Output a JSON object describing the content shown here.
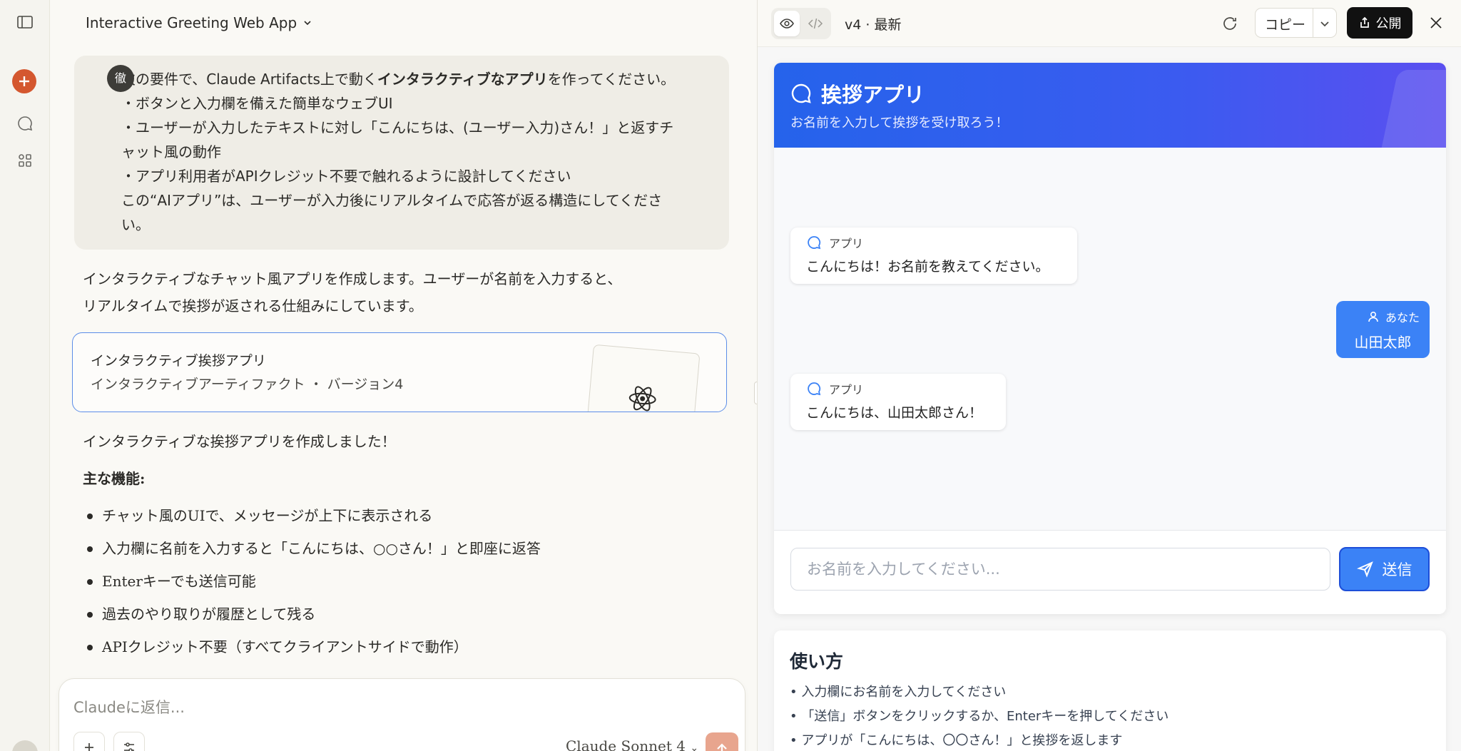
{
  "chat": {
    "title": "Interactive Greeting Web App",
    "user_avatar": "徹",
    "user_message": {
      "l1_pre": "次の要件で、Claude Artifacts上で動く",
      "l1_bold": "インタラクティブなアプリ",
      "l1_post": "を作ってください。",
      "l2": "・ボタンと入力欄を備えた簡単なウェブUI",
      "l3": "・ユーザーが入力したテキストに対し「こんにちは、(ユーザー入力)さん！」と返すチ",
      "l4": "ャット風の動作",
      "l5": "・アプリ利用者がAPIクレジット不要で触れるように設計してください",
      "l6": "この“AIアプリ”は、ユーザーが入力後にリアルタイムで応答が返る構造にしてくださ",
      "l7": "い。"
    },
    "assistant_intro_1": "インタラクティブなチャット風アプリを作成します。ユーザーが名前を入力すると、",
    "assistant_intro_2": "リアルタイムで挨拶が返される仕組みにしています。",
    "artifact": {
      "title": "インタラクティブ挨拶アプリ",
      "subtitle": "インタラクティブアーティファクト ・ バージョン4"
    },
    "assistant_done": "インタラクティブな挨拶アプリを作成しました！",
    "features_title": "主な機能:",
    "features": [
      "チャット風のUIで、メッセージが上下に表示される",
      "入力欄に名前を入力すると「こんにちは、○○さん！」と即座に返答",
      "Enterキーでも送信可能",
      "過去のやり取りが履歴として残る",
      "APIクレジット不要（すべてクライアントサイドで動作）"
    ],
    "reply_placeholder": "Claudeに返信...",
    "model_name": "Claude Sonnet 4"
  },
  "panel": {
    "version": "v4 · 最新",
    "copy_label": "コピー",
    "publish_label": "公開"
  },
  "app": {
    "title": "挨拶アプリ",
    "subtitle": "お名前を入力して挨拶を受け取ろう！",
    "bot_label": "アプリ",
    "user_label": "あなた",
    "messages": [
      {
        "from": "bot",
        "text": "こんにちは！お名前を教えてください。"
      },
      {
        "from": "user",
        "text": "山田太郎"
      },
      {
        "from": "bot",
        "text": "こんにちは、山田太郎さん！"
      }
    ],
    "input_placeholder": "お名前を入力してください...",
    "send_label": "送信",
    "howto": {
      "title": "使い方",
      "items": [
        "入力欄にお名前を入力してください",
        "「送信」ボタンをクリックするか、Enterキーを押してください",
        "アプリが「こんにちは、〇〇さん！」と挨拶を返します"
      ]
    },
    "colors": {
      "header_start": "#2563eb",
      "header_end": "#5b4ff0",
      "user_bubble": "#3b82f6",
      "new_chat": "#d4572f"
    }
  }
}
